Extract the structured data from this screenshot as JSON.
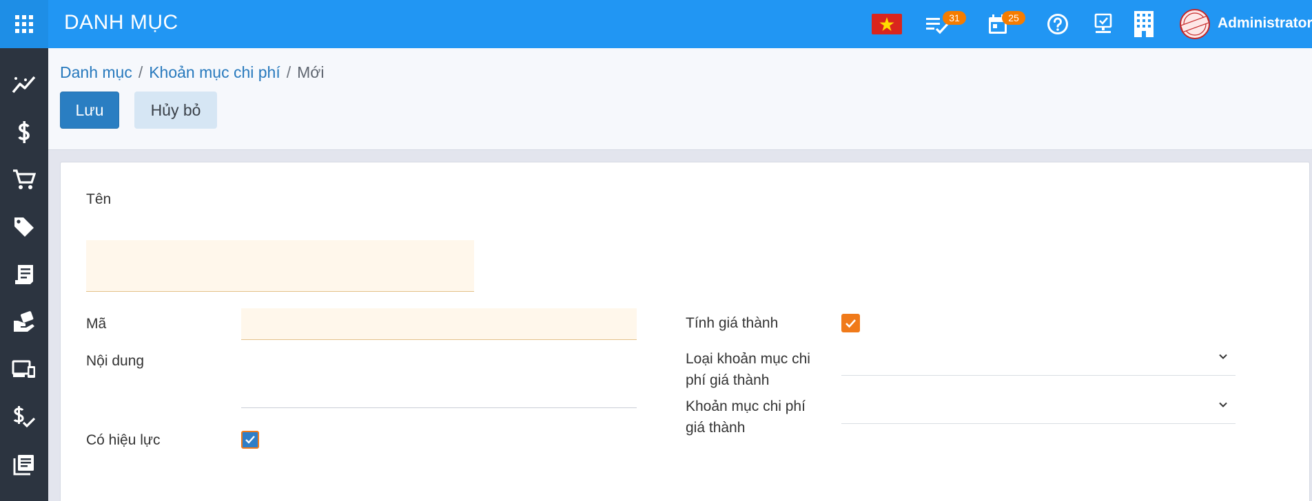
{
  "header": {
    "app_title": "DANH MỤC",
    "tasks_badge": "31",
    "calendar_badge": "25",
    "user_name": "Administrator",
    "flag_color": "#da251d",
    "bar_color": "#2196f3",
    "badge_color": "#f57c00"
  },
  "sidebar": {
    "items": [
      {
        "icon": "chart-line-icon"
      },
      {
        "icon": "dollar-icon"
      },
      {
        "icon": "cart-icon"
      },
      {
        "icon": "tag-icon"
      },
      {
        "icon": "receipt-icon"
      },
      {
        "icon": "hand-money-icon"
      },
      {
        "icon": "devices-icon"
      },
      {
        "icon": "dollar-check-icon"
      },
      {
        "icon": "library-books-icon"
      }
    ]
  },
  "breadcrumb": {
    "root": "Danh mục",
    "parent": "Khoản mục chi phí",
    "current": "Mới",
    "separator": "/"
  },
  "actions": {
    "save_label": "Lưu",
    "cancel_label": "Hủy bỏ"
  },
  "form": {
    "name_label": "Tên",
    "name_value": "",
    "code_label": "Mã",
    "code_value": "",
    "content_label": "Nội dung",
    "content_value": "",
    "active_label": "Có hiệu lực",
    "active_checked": true,
    "costing_label": "Tính giá thành",
    "costing_checked": true,
    "cost_item_type_label": "Loại khoản mục chi phí giá thành",
    "cost_item_type_value": "",
    "cost_item_label": "Khoản mục chi phí giá thành",
    "cost_item_value": ""
  }
}
